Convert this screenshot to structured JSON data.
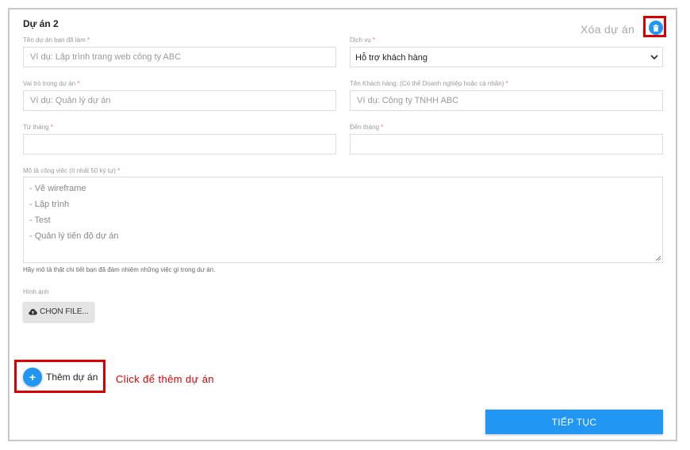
{
  "project": {
    "title": "Dự án 2",
    "delete_label": "Xóa dự án"
  },
  "fields": {
    "project_name": {
      "label": "Tên dự án bạn đã làm",
      "placeholder": "Ví dụ: Lập trình trang web công ty ABC"
    },
    "service": {
      "label": "Dịch vụ",
      "value": "Hỗ trợ khách hàng"
    },
    "role": {
      "label": "Vai trò trong dự án",
      "placeholder": "Ví dụ: Quản lý dự án"
    },
    "client": {
      "label": "Tên Khách hàng: (Có thể Doanh nghiệp hoặc cá nhân)",
      "placeholder": "Ví dụ: Công ty TNHH ABC"
    },
    "from_month": {
      "label": "Từ tháng",
      "value": ""
    },
    "to_month": {
      "label": "Đến tháng",
      "value": ""
    },
    "description": {
      "label": "Mô tả công việc (ít nhất 50 ký tự)",
      "lines": [
        "- Vẽ wireframe",
        "- Lập trình",
        "- Test",
        "- Quản lý tiến độ dự án"
      ],
      "hint": "Hãy mô tả thật chi tiết bạn đã đảm nhiệm những việc gì trong dự án."
    },
    "image": {
      "label": "Hình ảnh",
      "button_label": "CHỌN FILE..."
    }
  },
  "required_mark": "*",
  "add_project": {
    "label": "Thêm dự án",
    "plus": "+"
  },
  "annotation": "Click để thêm dự án",
  "next_button": "TIẾP TỤC",
  "colors": {
    "accent": "#2196f3",
    "annotation": "#d80000"
  },
  "icons": [
    "trash-icon",
    "chevron-down-icon",
    "cloud-upload-icon",
    "plus-icon",
    "resize-handle-icon"
  ]
}
